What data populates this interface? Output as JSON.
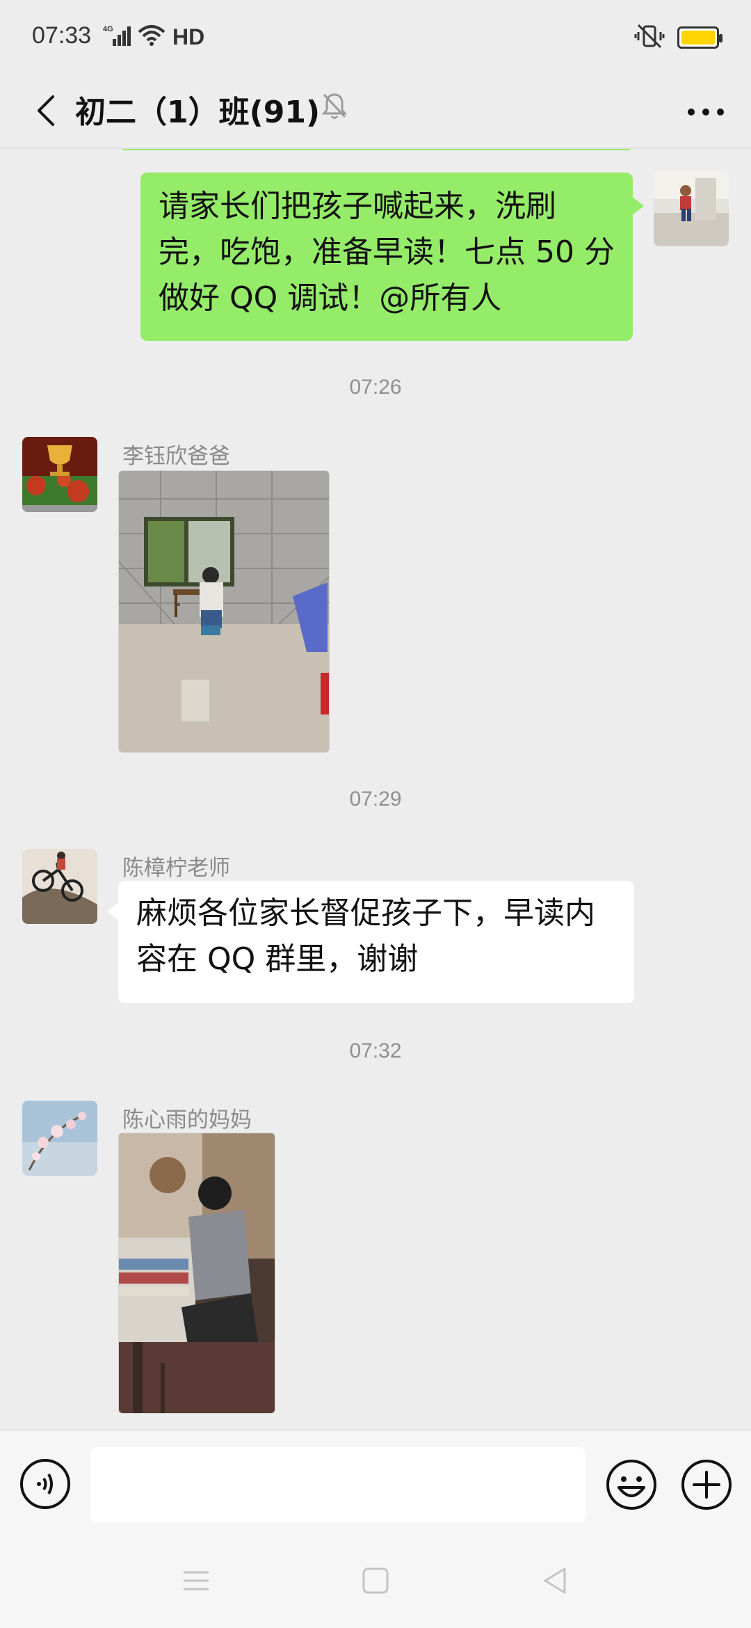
{
  "status_bar": {
    "time": "07:33",
    "network": "4G",
    "hd_label": "HD",
    "battery_color": "#ffd400"
  },
  "header": {
    "title": "初二（1）班(91)",
    "back_icon": "chevron-left-icon",
    "mute_icon": "bell-off-icon",
    "more_icon": "more-horizontal-icon"
  },
  "messages": [
    {
      "type": "text",
      "side": "right",
      "text": "请家长们把孩子喊起来，洗刷完，吃饱，准备早读！七点 50 分做好 QQ 调试！@所有人"
    },
    {
      "type": "timestamp",
      "text": "07:26"
    },
    {
      "type": "image",
      "side": "left",
      "sender": "李钰欣爸爸"
    },
    {
      "type": "timestamp",
      "text": "07:29"
    },
    {
      "type": "text",
      "side": "left",
      "sender": "陈樟柠老师",
      "text": "麻烦各位家长督促孩子下，早读内容在 QQ 群里，谢谢"
    },
    {
      "type": "timestamp",
      "text": "07:32"
    },
    {
      "type": "image",
      "side": "left",
      "sender": "陈心雨的妈妈"
    }
  ],
  "input_bar": {
    "placeholder": "",
    "voice_icon": "voice-icon",
    "emoji_icon": "emoji-icon",
    "plus_icon": "plus-circle-icon"
  },
  "colors": {
    "own_bubble": "#95ec69",
    "other_bubble": "#ffffff",
    "background": "#ededed"
  }
}
